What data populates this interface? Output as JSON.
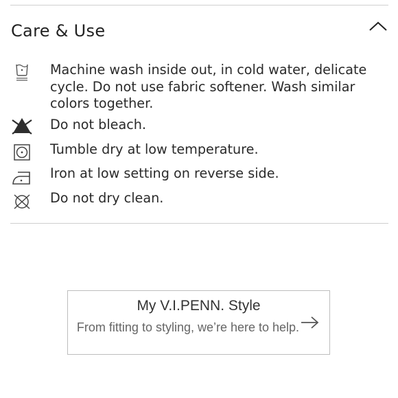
{
  "section": {
    "title": "Care & Use",
    "toggle_icon": "chevron-up-icon"
  },
  "care_items": [
    {
      "icon": "machine-wash-cold-icon",
      "text": "Machine wash inside out, in cold water, delicate cycle. Do not use fabric softener. Wash similar colors together."
    },
    {
      "icon": "do-not-bleach-icon",
      "text": "Do not bleach."
    },
    {
      "icon": "tumble-dry-low-icon",
      "text": "Tumble dry at low temperature."
    },
    {
      "icon": "iron-low-icon",
      "text": "Iron at low setting on reverse side."
    },
    {
      "icon": "do-not-dry-clean-icon",
      "text": "Do not dry clean."
    }
  ],
  "promo": {
    "title": "My V.I.PENN. Style",
    "subtitle": "From fitting to styling, we’re here to help.",
    "arrow_icon": "arrow-right-icon"
  }
}
